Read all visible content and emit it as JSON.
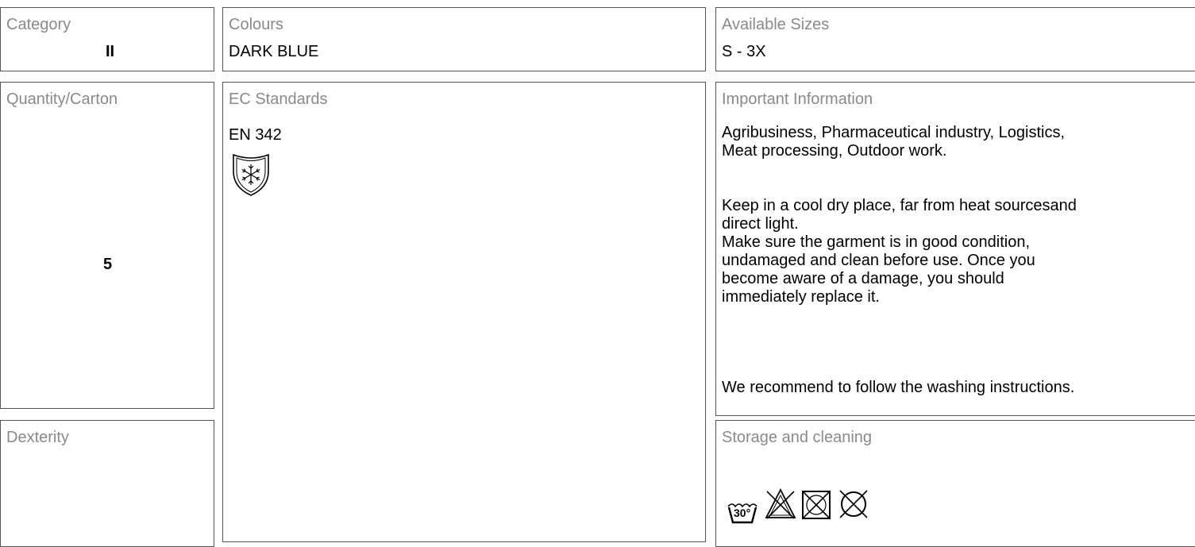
{
  "category": {
    "label": "Category",
    "value": "II"
  },
  "colours": {
    "label": "Colours",
    "value": "DARK BLUE"
  },
  "sizes": {
    "label": "Available Sizes",
    "value": "S - 3X"
  },
  "quantity": {
    "label": "Quantity/Carton",
    "value": "5"
  },
  "ec_standards": {
    "label": "EC Standards",
    "value": "EN 342",
    "icon": "cold-protection-shield-icon"
  },
  "important": {
    "label": "Important Information",
    "para1_line1": "Agribusiness, Pharmaceutical industry, Logistics,",
    "para1_line2": "Meat processing, Outdoor work.",
    "para2_line1": "Keep in a cool dry place, far from heat sourcesand",
    "para2_line2": "direct light.",
    "para2_line3": "Make sure the garment is in good condition,",
    "para2_line4": "undamaged and clean before use. Once you",
    "para2_line5": "become aware of a damage, you should",
    "para2_line6": "immediately replace it.",
    "para3": "We recommend to follow the washing instructions."
  },
  "dexterity": {
    "label": "Dexterity"
  },
  "storage": {
    "label": "Storage and cleaning",
    "wash_temp": "30°",
    "icons": [
      "wash-30-icon",
      "no-bleach-icon",
      "no-tumble-dry-icon",
      "no-dry-clean-icon"
    ]
  }
}
